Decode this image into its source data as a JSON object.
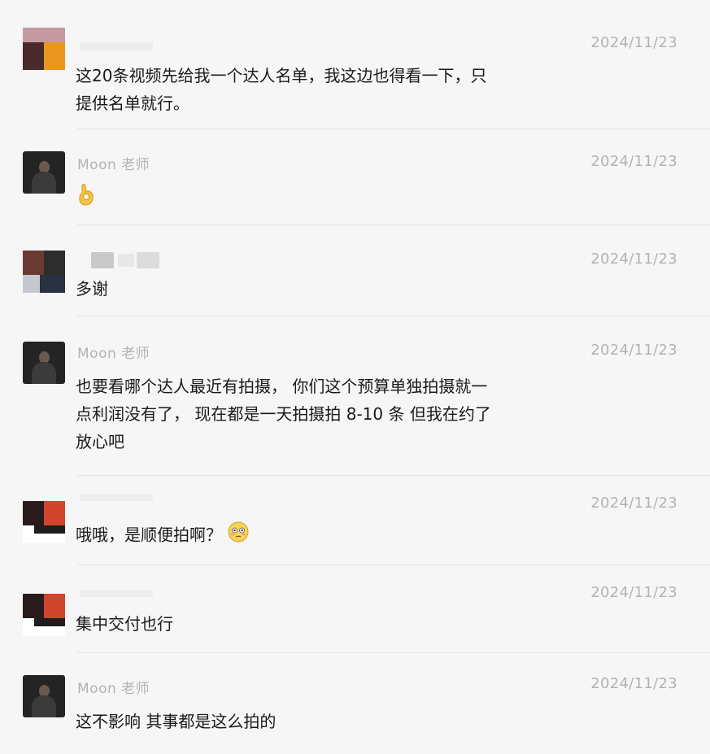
{
  "messages": [
    {
      "sender": "",
      "time": "2024/11/23",
      "lines": [
        "这20条视频先给我一个达人名单，我这边也得看一下，只",
        "提供名单就行。"
      ],
      "emoji": ""
    },
    {
      "sender": "Moon 老师",
      "time": "2024/11/23",
      "lines": [],
      "emoji": "ok-hand-emoji"
    },
    {
      "sender": "",
      "time": "2024/11/23",
      "lines": [
        "多谢"
      ],
      "emoji": ""
    },
    {
      "sender": "Moon 老师",
      "time": "2024/11/23",
      "lines": [
        "也要看哪个达人最近有拍摄， 你们这个预算单独拍摄就一",
        "点利润没有了， 现在都是一天拍摄拍 8-10 条 但我在约了",
        "放心吧"
      ],
      "emoji": ""
    },
    {
      "sender": "",
      "time": "2024/11/23",
      "lines": [
        "哦哦，是顺便拍啊？"
      ],
      "emoji": "flushed-face-emoji"
    },
    {
      "sender": "",
      "time": "2024/11/23",
      "lines": [
        "集中交付也行"
      ],
      "emoji": ""
    },
    {
      "sender": "Moon 老师",
      "time": "2024/11/23",
      "lines": [
        "这不影响 其事都是这么拍的"
      ],
      "emoji": ""
    }
  ],
  "colors": {
    "background": "#f6f6f6",
    "meta_text": "#b3b3b3",
    "body_text": "#1a1a1a",
    "divider": "#e4e4e4"
  }
}
